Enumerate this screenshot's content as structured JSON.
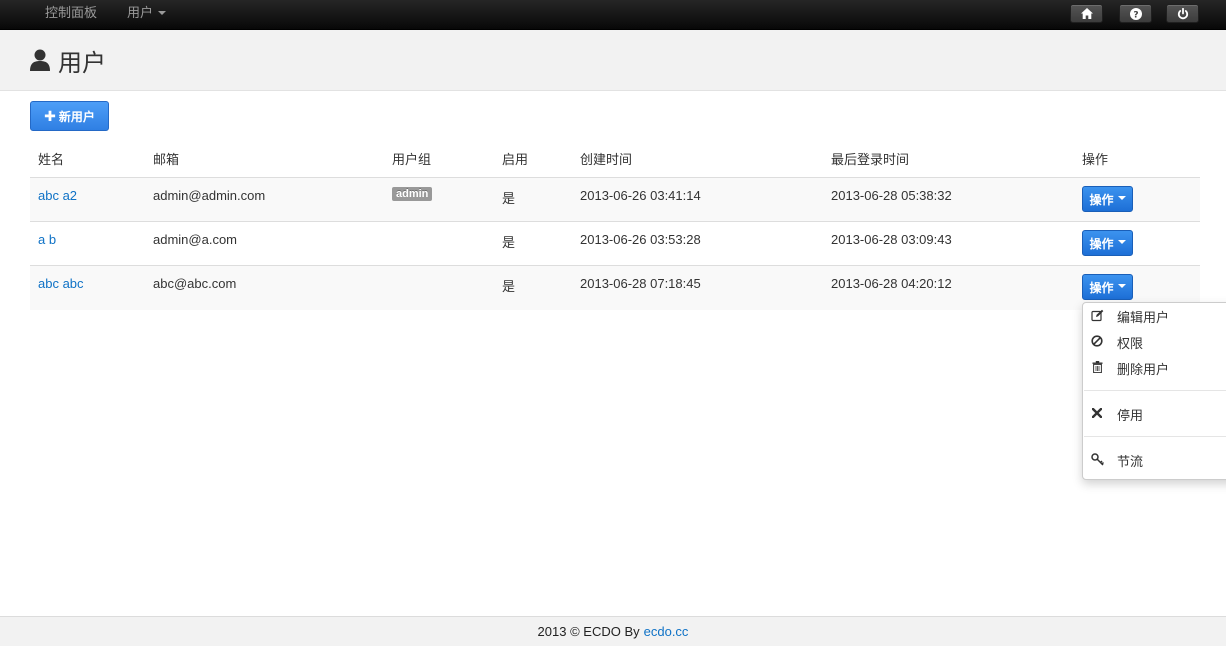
{
  "navbar": {
    "dashboard_label": "控制面板",
    "users_label": "用户",
    "right_buttons": [
      "home-icon",
      "question-icon",
      "power-icon"
    ]
  },
  "header": {
    "title": "用户",
    "icon": "user-icon"
  },
  "toolbar": {
    "new_user_label": "新用户"
  },
  "table": {
    "columns": [
      "姓名",
      "邮箱",
      "用户组",
      "启用",
      "创建时间",
      "最后登录时间",
      "操作"
    ],
    "rows": [
      {
        "name": "abc a2",
        "email": "admin@admin.com",
        "group": "admin",
        "enabled": "是",
        "created": "2013-06-26 03:41:14",
        "last_login": "2013-06-28 05:38:32",
        "action": "操作"
      },
      {
        "name": "a b",
        "email": "admin@a.com",
        "group": "",
        "enabled": "是",
        "created": "2013-06-26 03:53:28",
        "last_login": "2013-06-28 03:09:43",
        "action": "操作"
      },
      {
        "name": "abc abc",
        "email": "abc@abc.com",
        "group": "",
        "enabled": "是",
        "created": "2013-06-28 07:18:45",
        "last_login": "2013-06-28 04:20:12",
        "action": "操作"
      }
    ]
  },
  "dropdown": {
    "items": [
      {
        "label": "编辑用户",
        "icon": "edit-icon"
      },
      {
        "label": "权限",
        "icon": "ban-icon"
      },
      {
        "label": "删除用户",
        "icon": "trash-icon"
      },
      {
        "label": "停用",
        "icon": "remove-icon"
      },
      {
        "label": "节流",
        "icon": "key-icon"
      }
    ]
  },
  "footer": {
    "text": "2013 © ECDO By",
    "link": "ecdo.cc"
  },
  "colors": {
    "primary": "#2f7fe3",
    "link": "#0f72c6",
    "navbar": "#1b1b1b",
    "label": "#999999"
  }
}
